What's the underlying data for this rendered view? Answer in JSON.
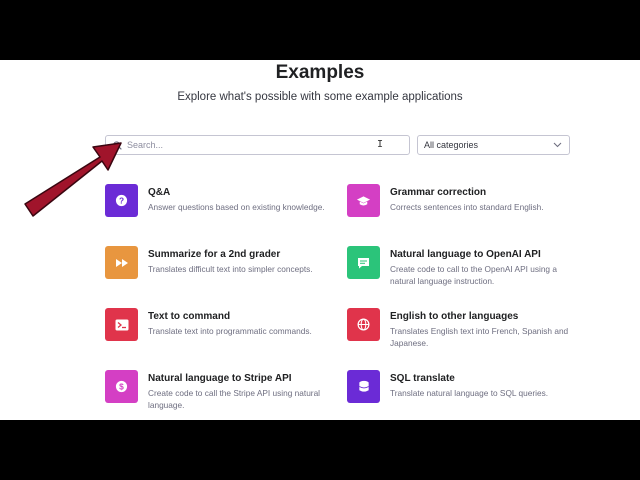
{
  "header": {
    "title": "Examples",
    "subtitle": "Explore what's possible with some example applications"
  },
  "search": {
    "placeholder": "Search..."
  },
  "category_select": {
    "selected": "All categories"
  },
  "examples": [
    {
      "title": "Q&A",
      "description": "Answer questions based on existing knowledge.",
      "color": "#6b2bd6",
      "icon": "question-icon"
    },
    {
      "title": "Grammar correction",
      "description": "Corrects sentences into standard English.",
      "color": "#d43fc4",
      "icon": "graduation-cap-icon"
    },
    {
      "title": "Summarize for a 2nd grader",
      "description": "Translates difficult text into simpler concepts.",
      "color": "#e8963f",
      "icon": "fast-forward-icon"
    },
    {
      "title": "Natural language to OpenAI API",
      "description": "Create code to call to the OpenAI API using a natural language instruction.",
      "color": "#2bc47a",
      "icon": "chat-icon"
    },
    {
      "title": "Text to command",
      "description": "Translate text into programmatic commands.",
      "color": "#e0344b",
      "icon": "terminal-icon"
    },
    {
      "title": "English to other languages",
      "description": "Translates English text into French, Spanish and Japanese.",
      "color": "#e0344b",
      "icon": "globe-icon"
    },
    {
      "title": "Natural language to Stripe API",
      "description": "Create code to call the Stripe API using natural language.",
      "color": "#d43fc4",
      "icon": "dollar-icon"
    },
    {
      "title": "SQL translate",
      "description": "Translate natural language to SQL queries.",
      "color": "#6b2bd6",
      "icon": "database-icon"
    }
  ],
  "colors": {
    "arrow": "#a0142b"
  }
}
